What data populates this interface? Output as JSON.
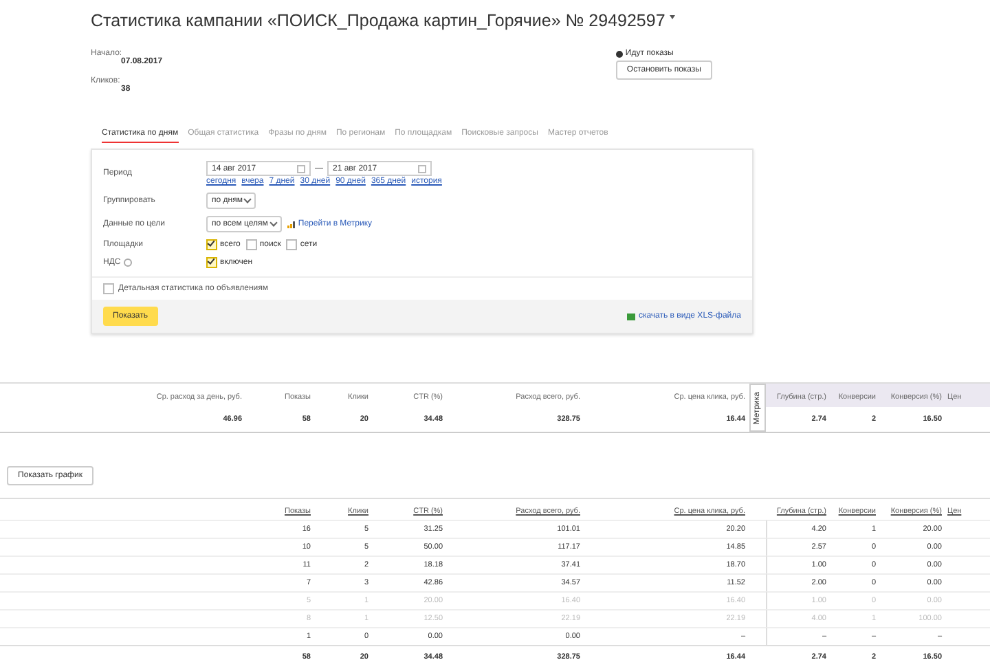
{
  "title": "Статистика кампании «ПОИСК_Продажа картин_Горячие» № 29492597",
  "info": [
    {
      "label": "Начало:",
      "value": "07.08.2017"
    },
    {
      "label": "Кликов:",
      "value": "38"
    }
  ],
  "status": {
    "text": "Идут показы",
    "active": true
  },
  "stop_button": "Остановить показы",
  "tabs": [
    {
      "label": "Статистика по дням",
      "selected": true
    },
    {
      "label": "Общая статистика",
      "selected": false
    },
    {
      "label": "Фразы по дням",
      "selected": false
    },
    {
      "label": "По регионам",
      "selected": false
    },
    {
      "label": "По площадкам",
      "selected": false
    },
    {
      "label": "Поисковые запросы",
      "selected": false
    },
    {
      "label": "Мастер отчетов",
      "selected": false
    }
  ],
  "period": {
    "label": "Период",
    "from": "14 авг 2017",
    "dash": "—",
    "to": "21 авг 2017",
    "presets": [
      "сегодня",
      "вчера",
      "7 дней",
      "30 дней",
      "90 дней",
      "365 дней",
      "история"
    ]
  },
  "group": {
    "label": "Группировать",
    "value": "по дням"
  },
  "goal": {
    "label": "Данные по цели",
    "value": "по всем целям",
    "link": "Перейти в Метрику"
  },
  "platforms": {
    "label": "Площадки",
    "options": [
      {
        "label": "всего",
        "checked": true
      },
      {
        "label": "поиск",
        "checked": false
      },
      {
        "label": "сети",
        "checked": false
      }
    ]
  },
  "vat": {
    "label": "НДС",
    "options": [
      {
        "label": "включен",
        "checked": true
      }
    ]
  },
  "detailed": {
    "label": "Детальная статистика по объявлениям",
    "checked": false
  },
  "show_button": "Показать",
  "download_link": "скачать в виде XLS-файла",
  "summary": {
    "columns": [
      "Ср. расход за день, руб.",
      "Показы",
      "Клики",
      "CTR (%)",
      "Расход всего, руб.",
      "Ср. цена клика, руб.",
      "Глубина (стр.)",
      "Конверсии",
      "Конверсия (%)",
      "Цен"
    ],
    "metrika_tab": "Метрика",
    "values": [
      "46.96",
      "58",
      "20",
      "34.48",
      "328.75",
      "16.44",
      "2.74",
      "2",
      "16.50"
    ]
  },
  "chart_button": "Показать график",
  "table": {
    "columns": [
      "Показы",
      "Клики",
      "CTR (%)",
      "Расход всего, руб.",
      "Ср. цена клика, руб.",
      "Глубина (стр.)",
      "Конверсии",
      "Конверсия (%)",
      "Цен"
    ],
    "rows": [
      {
        "cells": [
          "16",
          "5",
          "31.25",
          "101.01",
          "20.20",
          "4.20",
          "1",
          "20.00"
        ],
        "dimmed": false
      },
      {
        "cells": [
          "10",
          "5",
          "50.00",
          "117.17",
          "14.85",
          "2.57",
          "0",
          "0.00"
        ],
        "dimmed": false
      },
      {
        "cells": [
          "11",
          "2",
          "18.18",
          "37.41",
          "18.70",
          "1.00",
          "0",
          "0.00"
        ],
        "dimmed": false
      },
      {
        "cells": [
          "7",
          "3",
          "42.86",
          "34.57",
          "11.52",
          "2.00",
          "0",
          "0.00"
        ],
        "dimmed": false
      },
      {
        "cells": [
          "5",
          "1",
          "20.00",
          "16.40",
          "16.40",
          "1.00",
          "0",
          "0.00"
        ],
        "dimmed": true
      },
      {
        "cells": [
          "8",
          "1",
          "12.50",
          "22.19",
          "22.19",
          "4.00",
          "1",
          "100.00"
        ],
        "dimmed": true
      },
      {
        "cells": [
          "1",
          "0",
          "0.00",
          "0.00",
          "–",
          "–",
          "–",
          "–"
        ],
        "dimmed": false
      }
    ],
    "total": [
      "58",
      "20",
      "34.48",
      "328.75",
      "16.44",
      "2.74",
      "2",
      "16.50"
    ]
  }
}
